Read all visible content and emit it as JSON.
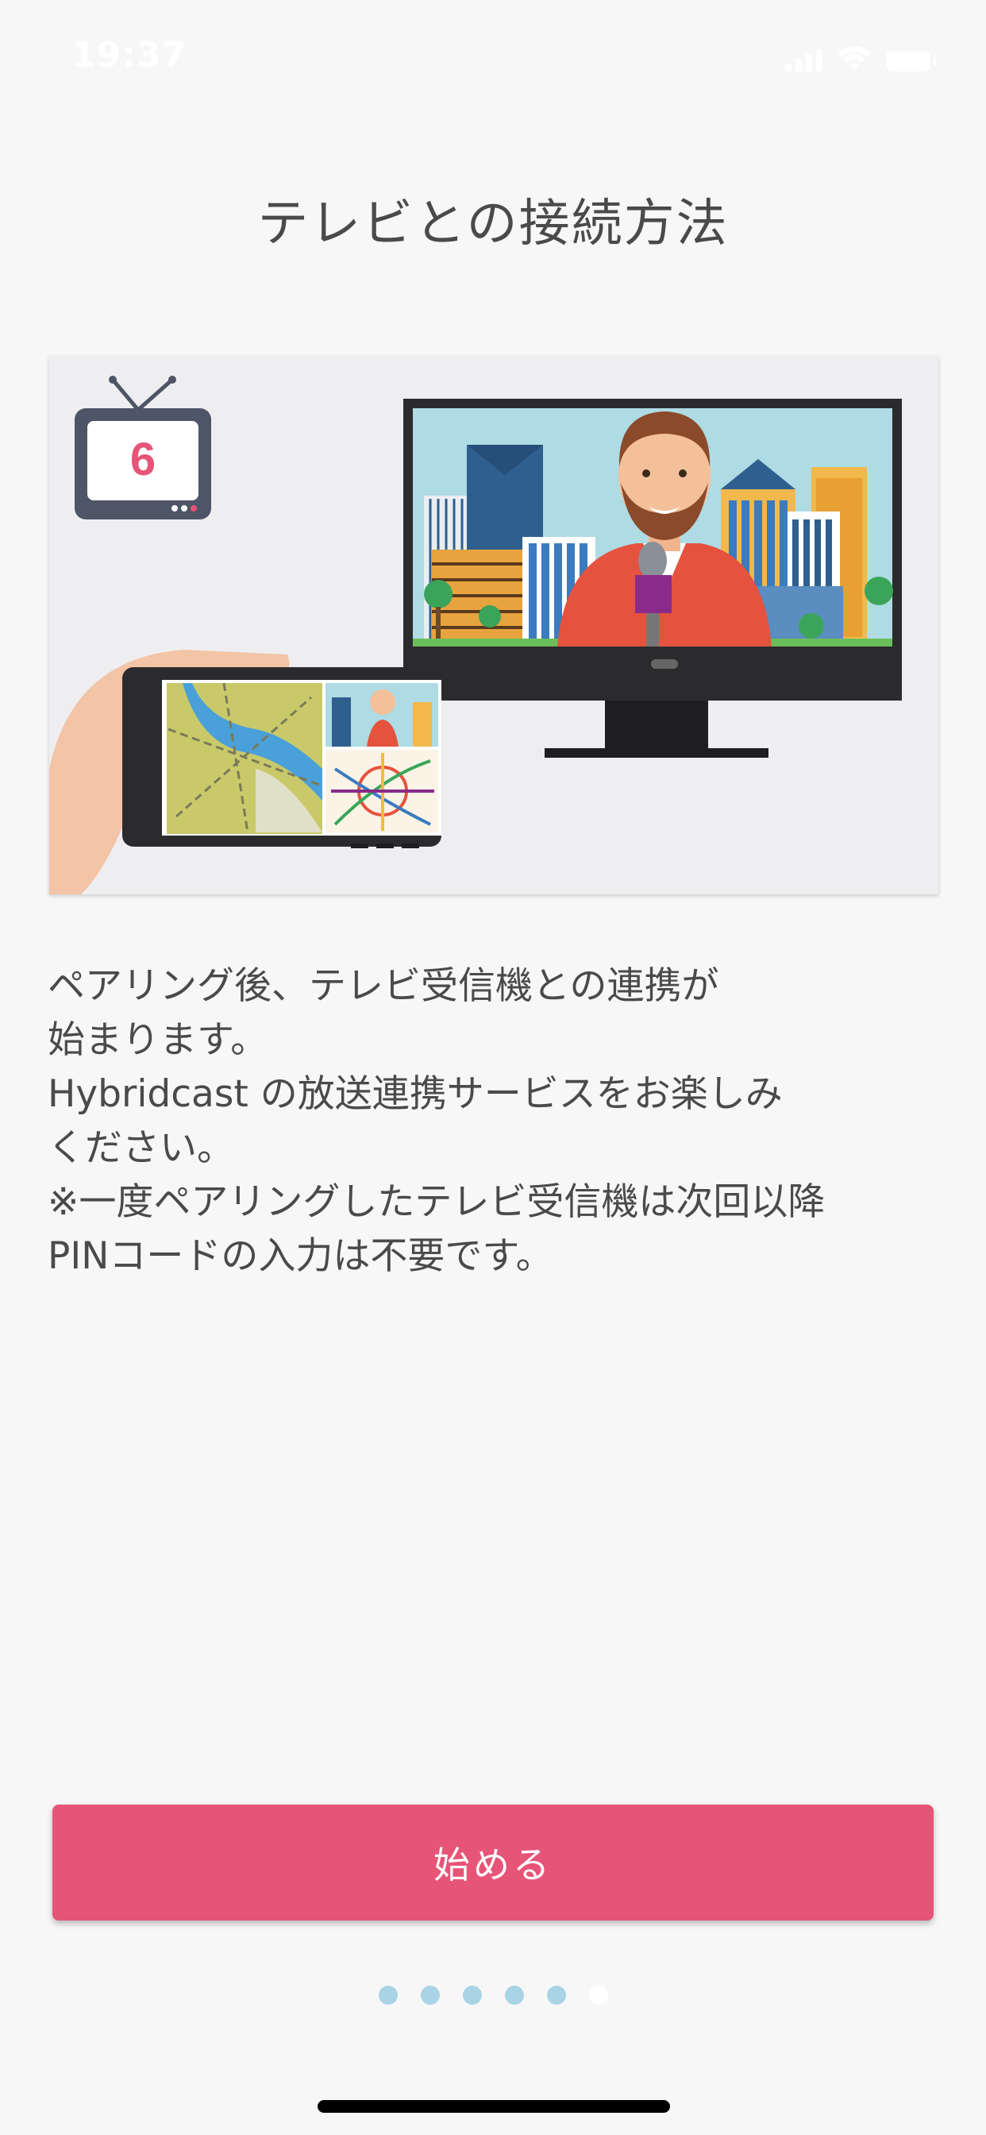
{
  "status_bar": {
    "time": "19:37",
    "icons": [
      "cellular-signal-icon",
      "wifi-icon",
      "battery-icon"
    ]
  },
  "header": {
    "title": "テレビとの接続方法"
  },
  "illustration": {
    "tv_channel_number": "6",
    "icons": [
      "tv-channel-icon",
      "television-icon",
      "smartphone-icon",
      "news-anchor-icon",
      "map-icon",
      "subway-map-icon"
    ]
  },
  "body": {
    "lines": [
      "ペアリング後、テレビ受信機との連携が",
      "始まります。",
      "Hybridcast の放送連携サービスをお楽しみ",
      "ください。",
      "※一度ペアリングしたテレビ受信機は次回以降",
      "PINコードの入力は不要です。"
    ]
  },
  "start_button": {
    "label": "始める"
  },
  "pagination": {
    "total": 6,
    "current": 6
  },
  "colors": {
    "accent": "#e65477",
    "dot_inactive": "#a8d4e6",
    "dot_active": "#ffffff",
    "text": "#4a4a4a",
    "background": "#f7f7f8"
  }
}
